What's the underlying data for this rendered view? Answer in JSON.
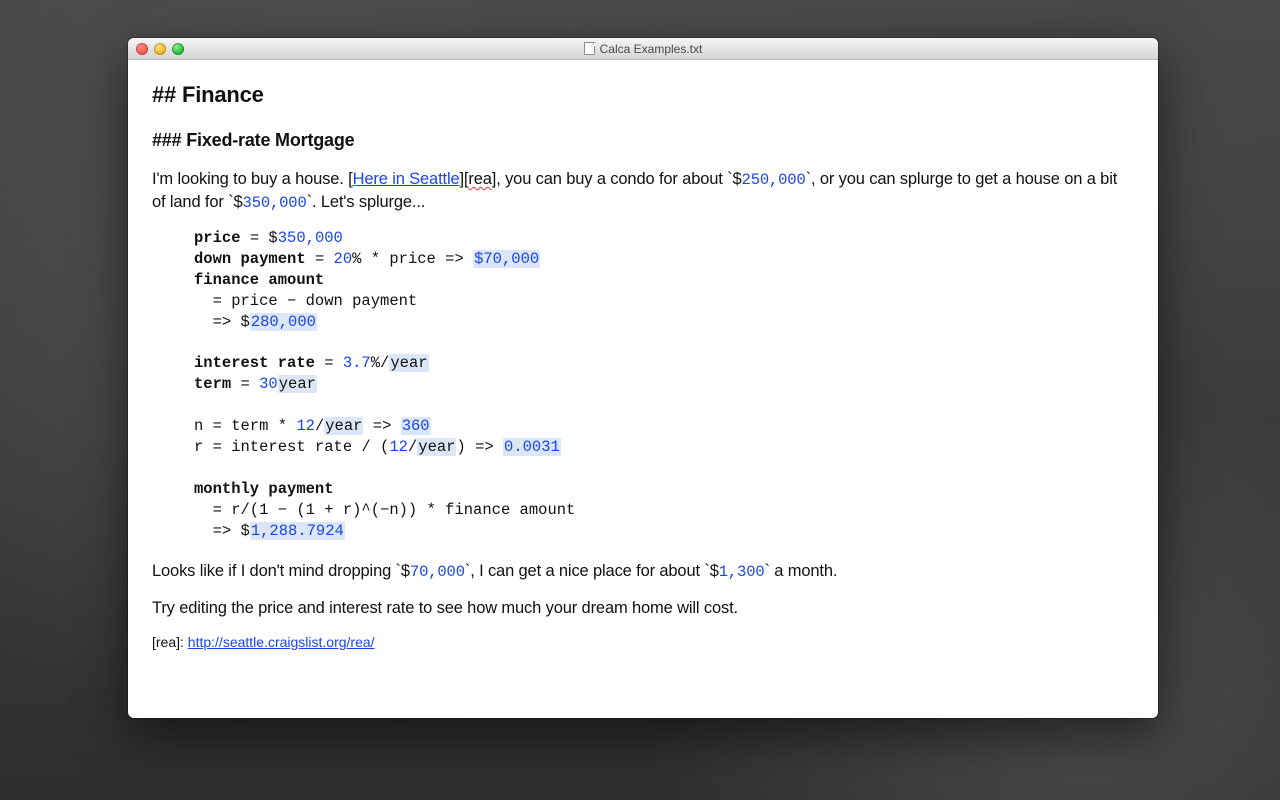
{
  "window": {
    "title": "Calca Examples.txt"
  },
  "doc": {
    "h2": "## Finance",
    "h3": "### Fixed-rate Mortgage",
    "intro": {
      "p1a": "I'm looking to buy a house. [",
      "link1": "Here in Seattle",
      "p1b": "][",
      "ref": "rea",
      "p1c": "], you can buy a condo for about `$",
      "condo_price": "250,000",
      "p1d": "`, or you can splurge to get a house on a bit of land for `$",
      "house_price": "350,000",
      "p1e": "`. Let's splurge..."
    },
    "code": {
      "l1a": "price",
      "l1b": " = $",
      "l1v": "350,000",
      "l2a": "down payment",
      "l2b": " = ",
      "l2p": "20",
      "l2c": "% * price => ",
      "l2r": "$70,000",
      "l3a": "finance amount",
      "l4": "  = price − down payment",
      "l5a": "  => $",
      "l5v": "280,000",
      "l6a": "interest rate",
      "l6b": " = ",
      "l6v": "3.7",
      "l6c": "%/",
      "l6u": "year",
      "l7a": "term",
      "l7b": " = ",
      "l7v": "30",
      "l7u": "year",
      "l8a": "n = term * ",
      "l8v": "12",
      "l8b": "/",
      "l8u": "year",
      "l8c": " => ",
      "l8r": "360",
      "l9a": "r = interest rate / (",
      "l9v": "12",
      "l9b": "/",
      "l9u": "year",
      "l9c": ") => ",
      "l9r": "0.0031",
      "l10a": "monthly payment",
      "l11": "  = r/(1 − (1 + r)^(−n)) * finance amount",
      "l12a": "  => $",
      "l12v": "1,288.7924"
    },
    "p2": {
      "a": "Looks like if I don't mind dropping `$",
      "v1": "70,000",
      "b": "`, I can get a nice place for about `$",
      "v2": "1,300",
      "c": "` a month."
    },
    "p3": "Try editing the price and interest rate to see how much your dream home will cost.",
    "footnote": {
      "label": "[rea]: ",
      "url": "http://seattle.craigslist.org/rea/"
    }
  }
}
